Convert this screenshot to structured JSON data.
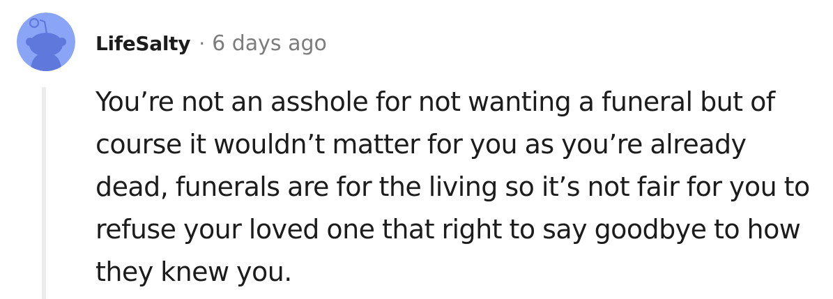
{
  "comment": {
    "username": "LifeSalty",
    "separator": "·",
    "timestamp": "6 days ago",
    "body": "You’re not an asshole for not wanting a funeral but of course it wouldn’t matter for you as you’re already dead, funerals are for the living so it’s not fair for you to refuse your loved one that right to say goodbye to how they knew you.",
    "avatar_icon": "snoo-avatar-icon"
  },
  "colors": {
    "avatar_background": "#8aa4f6",
    "avatar_figure": "#5e78dc",
    "username": "#1c1c1c",
    "timestamp": "#7c7c7c",
    "body_text": "#1c1c1c",
    "thread_line": "#ececec"
  }
}
